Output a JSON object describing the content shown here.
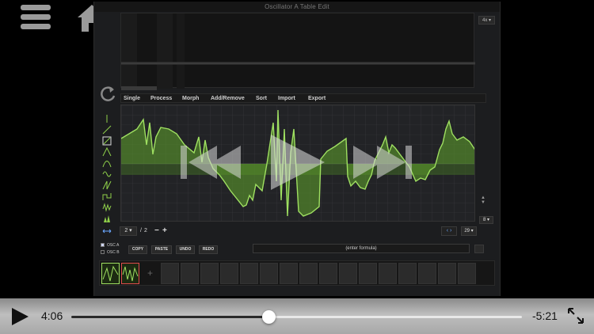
{
  "window_title": "Oscillator A Table Edit",
  "zoom": "4x",
  "tabs": [
    "Single",
    "Process",
    "Morph",
    "Add/Remove",
    "Sort",
    "Import",
    "Export"
  ],
  "frame": {
    "current": "2",
    "separator": "/",
    "total": "2"
  },
  "frame_buttons": {
    "minus": "−",
    "plus": "+"
  },
  "right_value": "8",
  "resolution": "29",
  "osc": {
    "a": "OSC A",
    "b": "OSC B"
  },
  "buttons": {
    "copy": "COPY",
    "paste": "PASTE",
    "undo": "UNDO",
    "redo": "REDO"
  },
  "formula_placeholder": "(enter formula)",
  "strip_add": "+",
  "player": {
    "current_time": "4:06",
    "remaining_time": "-5:21",
    "progress": 0.437
  },
  "colors": {
    "wave_green": "#8fd04a",
    "accent_red": "#e04c4c",
    "panel_bg": "#222326"
  }
}
